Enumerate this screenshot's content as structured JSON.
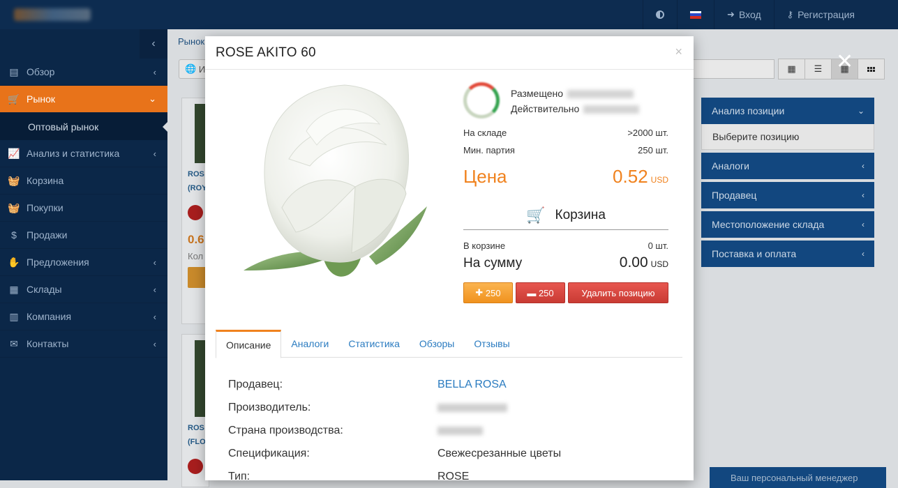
{
  "topbar": {
    "login": "Вход",
    "register": "Регистрация"
  },
  "sidebar": {
    "items": [
      {
        "label": "Обзор",
        "icon": "dashboard-icon"
      },
      {
        "label": "Рынок",
        "icon": "cart-icon",
        "active": true
      },
      {
        "label": "Анализ и статистика",
        "icon": "chart-icon"
      },
      {
        "label": "Корзина",
        "icon": "basket-icon"
      },
      {
        "label": "Покупки",
        "icon": "purchases-icon"
      },
      {
        "label": "Продажи",
        "icon": "sales-icon"
      },
      {
        "label": "Предложения",
        "icon": "offers-icon"
      },
      {
        "label": "Склады",
        "icon": "warehouse-icon"
      },
      {
        "label": "Компания",
        "icon": "building-icon"
      },
      {
        "label": "Контакты",
        "icon": "envelope-icon"
      }
    ],
    "sub_item": "Оптовый рынок"
  },
  "main": {
    "breadcrumb": "Рынок",
    "filter_label": "И",
    "cards": [
      {
        "name_line1": "ROS",
        "name_line2": "(ROY",
        "price": "0.6",
        "qty": "Кол"
      },
      {
        "name_line1": "ROS",
        "name_line2": "(FLO"
      }
    ],
    "right_panels": [
      {
        "title": "Анализ позиции",
        "open": true,
        "body": "Выберите позицию"
      },
      {
        "title": "Аналоги"
      },
      {
        "title": "Продавец"
      },
      {
        "title": "Местоположение склада"
      },
      {
        "title": "Поставка и оплата"
      }
    ],
    "manager_tab": "Ваш персональный менеджер"
  },
  "modal": {
    "title": "ROSE AKITO 60",
    "seller_placed_label": "Размещено",
    "seller_valid_label": "Действительно",
    "stock_label": "На складе",
    "stock_value": ">2000 шт.",
    "min_lot_label": "Мин. партия",
    "min_lot_value": "250 шт.",
    "price_label": "Цена",
    "price_value": "0.52",
    "currency": "USD",
    "cart_label": "Корзина",
    "in_cart_label": "В корзине",
    "in_cart_value": "0 шт.",
    "sum_label": "На сумму",
    "sum_value": "0.00",
    "btn_plus": "250",
    "btn_minus": "250",
    "btn_delete": "Удалить позицию",
    "tabs": [
      "Описание",
      "Аналоги",
      "Статистика",
      "Обзоры",
      "Отзывы"
    ],
    "details": [
      {
        "label": "Продавец:",
        "value": "BELLA ROSA"
      },
      {
        "label": "Производитель:",
        "value": ""
      },
      {
        "label": "Страна производства:",
        "value": ""
      },
      {
        "label": "Спецификация:",
        "value": "Свежесрезанные цветы"
      },
      {
        "label": "Тип:",
        "value": "ROSE"
      }
    ]
  },
  "colors": {
    "topbar": "#0d2c50",
    "sidebar": "#0b2748",
    "active_menu": "#e8731a",
    "accent_price": "#f0821e",
    "link": "#2a7bc0",
    "panel_head": "#12477f"
  }
}
